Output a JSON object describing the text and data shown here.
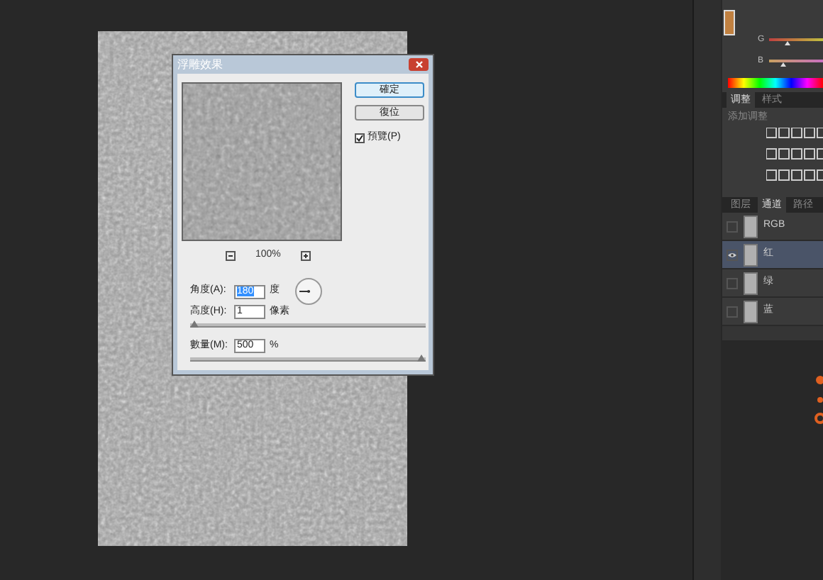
{
  "dialog": {
    "title": "浮雕效果",
    "buttons": [
      {
        "label": "確定",
        "default": true
      },
      {
        "label": "復位",
        "default": false
      }
    ],
    "preview": {
      "label": "預覽(P)",
      "checked": true
    },
    "zoom": "100%",
    "fields": [
      {
        "label": "角度(A):",
        "value": "180",
        "unit": "度",
        "focused": true
      },
      {
        "label": "高度(H):",
        "value": "1",
        "unit": "像素",
        "focused": false,
        "level": 0
      },
      {
        "label": "數量(M):",
        "value": "500",
        "unit": "%",
        "focused": false,
        "level": 1
      }
    ]
  },
  "color_panel": {
    "sliders": [
      {
        "label": "G",
        "level": 0.3
      },
      {
        "label": "B",
        "level": 0.2
      }
    ]
  },
  "adjust_panel": {
    "tabs": [
      {
        "label": "调整",
        "selected": true
      },
      {
        "label": "样式",
        "selected": false
      }
    ],
    "hint": "添加调整"
  },
  "layers_panel": {
    "tabs": [
      {
        "label": "图层",
        "selected": false
      },
      {
        "label": "通道",
        "selected": true
      },
      {
        "label": "路径",
        "selected": false
      }
    ],
    "channels": [
      {
        "name": "RGB",
        "visible": false,
        "selected": false
      },
      {
        "name": "红",
        "visible": true,
        "selected": true
      },
      {
        "name": "绿",
        "visible": false,
        "selected": false
      },
      {
        "name": "蓝",
        "visible": false,
        "selected": false
      }
    ]
  }
}
